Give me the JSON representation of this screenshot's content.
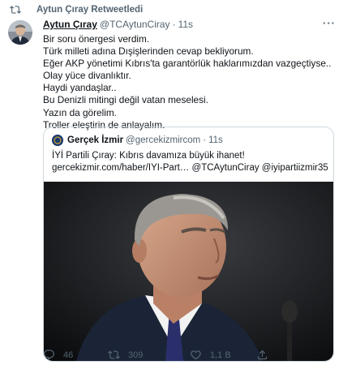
{
  "retweet": {
    "label": "Aytun Çıray Retweetledi",
    "icon": "retweet-icon"
  },
  "tweet": {
    "author_name": "Aytun Çıray",
    "author_handle": "@TCAytunCiray",
    "separator": "·",
    "time": "11s",
    "lines": [
      "Bir soru önergesi verdim.",
      "Türk milleti adına Dışişlerinden cevap bekliyorum.",
      "Eğer AKP yönetimi Kıbrıs'ta garantörlük haklarımızdan vazgeçtiyse..",
      "Olay yüce divanlıktır.",
      "Haydi yandaşlar..",
      "Bu Denizli mitingi değil vatan meselesi.",
      "Yazın da görelim.",
      "Troller eleştirin de anlayalım."
    ]
  },
  "quote": {
    "author_name": "Gerçek İzmir",
    "author_handle": "@gercekizmircom",
    "separator": "·",
    "time": "11s",
    "line1": "İYİ Partili Çıray: Kıbrıs davamıza büyük ihanet!",
    "line2": "gercekizmir.com/haber/IYI-Part… @TCAytunCiray @iyipartiizmir35"
  },
  "actions": {
    "reply_count": "46",
    "retweet_count": "309",
    "like_count": "1,1 B"
  },
  "colors": {
    "text": "#0f1419",
    "muted": "#536471",
    "border": "#cfd9de"
  }
}
